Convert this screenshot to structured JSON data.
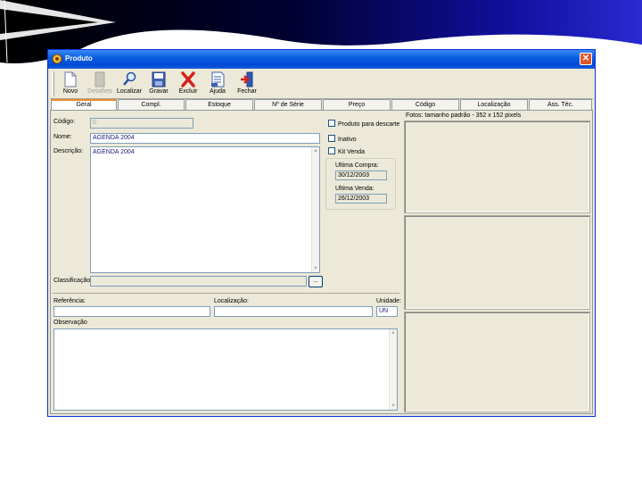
{
  "window": {
    "title": "Produto"
  },
  "toolbar": {
    "buttons": [
      {
        "label": "Novo",
        "icon": "new-document-icon",
        "enabled": true
      },
      {
        "label": "Detalhes",
        "icon": "details-icon",
        "enabled": false
      },
      {
        "label": "Localizar",
        "icon": "search-icon",
        "enabled": true
      },
      {
        "label": "Gravar",
        "icon": "save-icon",
        "enabled": true
      },
      {
        "label": "Excluir",
        "icon": "delete-icon",
        "enabled": true
      },
      {
        "label": "Ajuda",
        "icon": "help-icon",
        "enabled": true
      },
      {
        "label": "Fechar",
        "icon": "exit-icon",
        "enabled": true
      }
    ]
  },
  "tabs": [
    "Geral",
    "Compl.",
    "Estoque",
    "Nº de Série",
    "Preço",
    "Código",
    "Localização",
    "Ass. Téc."
  ],
  "active_tab": "Geral",
  "form": {
    "codigo_label": "Código:",
    "codigo_value": "0",
    "nome_label": "Nome:",
    "nome_value": "AGENDA 2004",
    "descricao_label": "Descrição:",
    "descricao_value": "AGENDA 2004",
    "classificacao_label": "Classificação:",
    "classificacao_value": "",
    "browse_label": "...",
    "referencia_label": "Referência:",
    "referencia_value": "",
    "localizacao_label": "Localização:",
    "localizacao_value": "",
    "unidade_label": "Unidade:",
    "unidade_value": "UN",
    "observacao_label": "Observação",
    "observacao_value": ""
  },
  "checkboxes": [
    {
      "label": "Produto para descarte",
      "checked": false
    },
    {
      "label": "Inativo",
      "checked": false
    },
    {
      "label": "Kit Venda",
      "checked": false
    }
  ],
  "dates": {
    "ultima_compra_label": "Ultima Compra:",
    "ultima_compra_value": "30/12/2003",
    "ultima_venda_label": "Ultima Venda:",
    "ultima_venda_value": "26/12/2003"
  },
  "photos": {
    "label": "Fotos: tamanho padrão - 352 x 152 pixels"
  },
  "colors": {
    "title_bar": "#0a5fe0",
    "slide_header": "#0a0a8c",
    "close_button": "#e0552b"
  }
}
